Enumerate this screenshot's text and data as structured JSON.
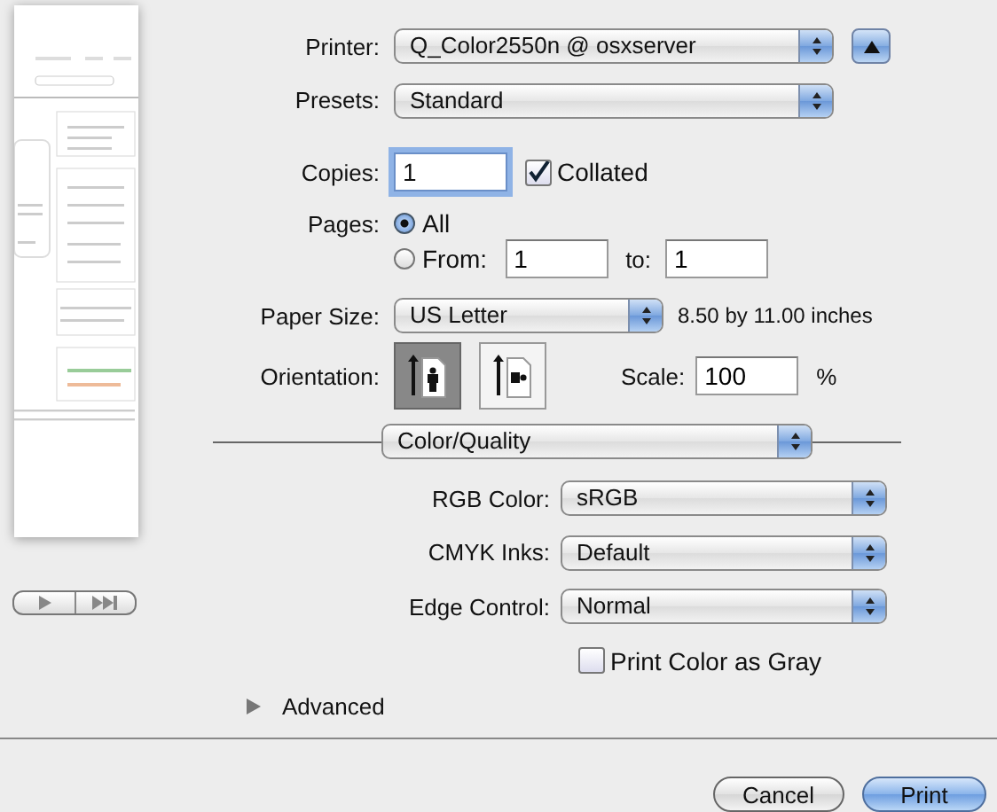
{
  "printer": {
    "label": "Printer:",
    "value": "Q_Color2550n @ osxserver",
    "expanded": false
  },
  "presets": {
    "label": "Presets:",
    "value": "Standard"
  },
  "copies": {
    "label": "Copies:",
    "value": "1"
  },
  "collated": {
    "label": "Collated",
    "checked": true
  },
  "pages": {
    "label": "Pages:",
    "options": [
      {
        "label": "All",
        "selected": true
      },
      {
        "label": "From:",
        "selected": false
      }
    ],
    "from": "1",
    "to_label": "to:",
    "to": "1"
  },
  "paper_size": {
    "label": "Paper Size:",
    "value": "US Letter",
    "dimensions": "8.50 by 11.00 inches"
  },
  "orientation": {
    "label": "Orientation:",
    "options": [
      {
        "kind": "portrait",
        "selected": true
      },
      {
        "kind": "landscape",
        "selected": false
      }
    ]
  },
  "scale": {
    "label": "Scale:",
    "value": "100",
    "unit": "%"
  },
  "panel": "Color/Quality",
  "color_settings": [
    {
      "label": "RGB Color:",
      "value": "sRGB"
    },
    {
      "label": "CMYK Inks:",
      "value": "Default"
    },
    {
      "label": "Edge Control:",
      "value": "Normal"
    }
  ],
  "print_as_gray": {
    "label": "Print Color as Gray",
    "checked": false
  },
  "advanced": {
    "label": "Advanced",
    "expanded": false
  },
  "buttons": [
    {
      "label": "Cancel",
      "default": false
    },
    {
      "label": "Print",
      "default": true
    }
  ]
}
